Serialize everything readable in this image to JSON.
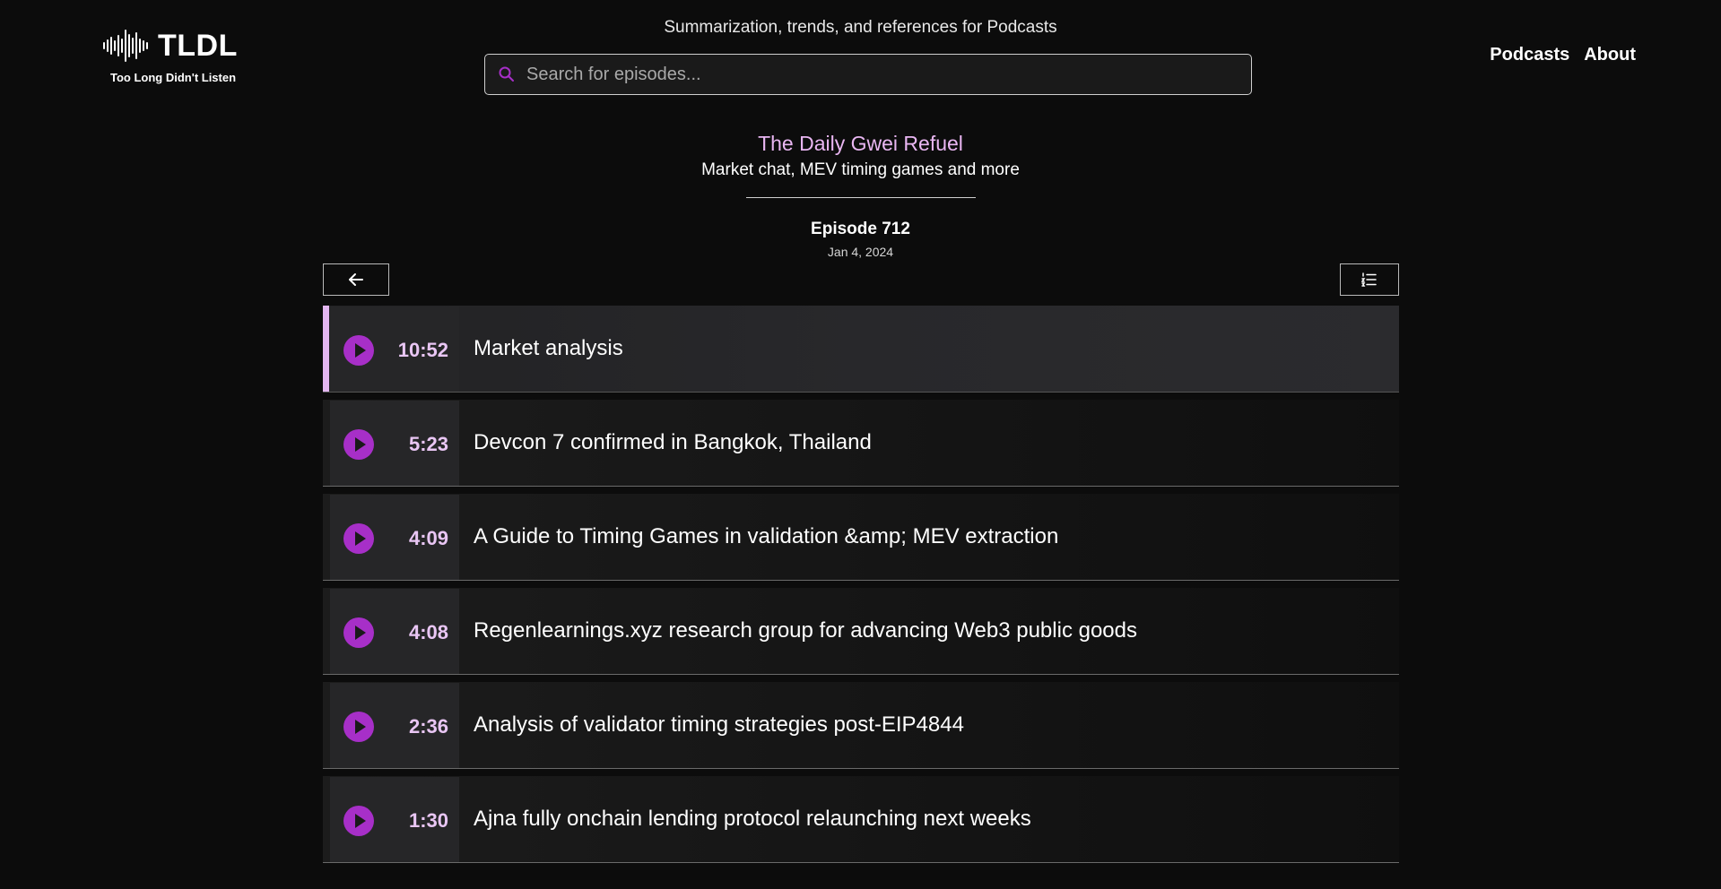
{
  "brand": {
    "name": "TLDL",
    "tagline": "Too Long Didn't Listen"
  },
  "header": {
    "subtitle": "Summarization, trends, and references for Podcasts",
    "search_placeholder": "Search for episodes...",
    "nav": {
      "podcasts": "Podcasts",
      "about": "About"
    }
  },
  "episode": {
    "show": "The Daily Gwei Refuel",
    "summary": "Market chat, MEV timing games and more",
    "number": "Episode 712",
    "date": "Jan 4, 2024"
  },
  "chapters": [
    {
      "time": "10:52",
      "title": "Market analysis",
      "active": true
    },
    {
      "time": "5:23",
      "title": "Devcon 7 confirmed in Bangkok, Thailand",
      "active": false
    },
    {
      "time": "4:09",
      "title": "A Guide to Timing Games in validation &amp; MEV extraction",
      "active": false
    },
    {
      "time": "4:08",
      "title": "Regenlearnings.xyz research group for advancing Web3 public goods",
      "active": false
    },
    {
      "time": "2:36",
      "title": "Analysis of validator timing strategies post-EIP4844",
      "active": false
    },
    {
      "time": "1:30",
      "title": "Ajna fully onchain lending protocol relaunching next weeks",
      "active": false
    }
  ],
  "colors": {
    "accent": "#a72fc8",
    "accent_light": "#e9b6f2",
    "background": "#0c0c0c"
  },
  "icons": {
    "logo": "waveform-icon",
    "search": "search-icon",
    "back": "arrow-left-icon",
    "list": "numbered-list-icon",
    "play": "play-icon"
  }
}
